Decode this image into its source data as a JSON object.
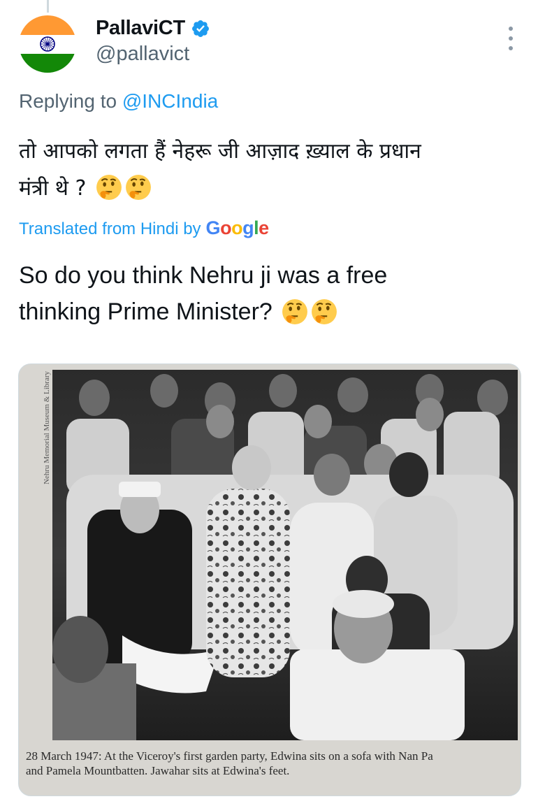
{
  "tweet": {
    "author": {
      "display_name": "PallaviCT",
      "handle": "@pallavict",
      "verified": true,
      "avatar_icon": "indian-flag-avatar"
    },
    "replying_prefix": "Replying to",
    "replying_to": "@INCIndia",
    "original_text_line1": "तो आपको लगता हैं नेहरू जी आज़ाद ख़्याल के प्रधान",
    "original_text_line2": "मंत्री थे ?",
    "translated_label": "Translated from Hindi by",
    "translation_provider": "Google",
    "translated_text_line1": "So do you think Nehru ji was a free",
    "translated_text_line2": "thinking Prime Minister?",
    "emoji": "thinking-face-icon",
    "emoji_count": 2,
    "media": {
      "side_credit": "Nehru Memorial Museum & Library",
      "caption_line1": "28 March 1947: At the Viceroy's first garden party, Edwina sits on a sofa with Nan Pa",
      "caption_line2": "and Pamela Mountbatten. Jawahar sits at Edwina's feet."
    }
  },
  "colors": {
    "accent": "#1d9bf0",
    "secondary_text": "#536471",
    "primary_text": "#0f1419",
    "flag_saffron": "#ff9933",
    "flag_green": "#138808",
    "flag_chakra": "#000080"
  }
}
